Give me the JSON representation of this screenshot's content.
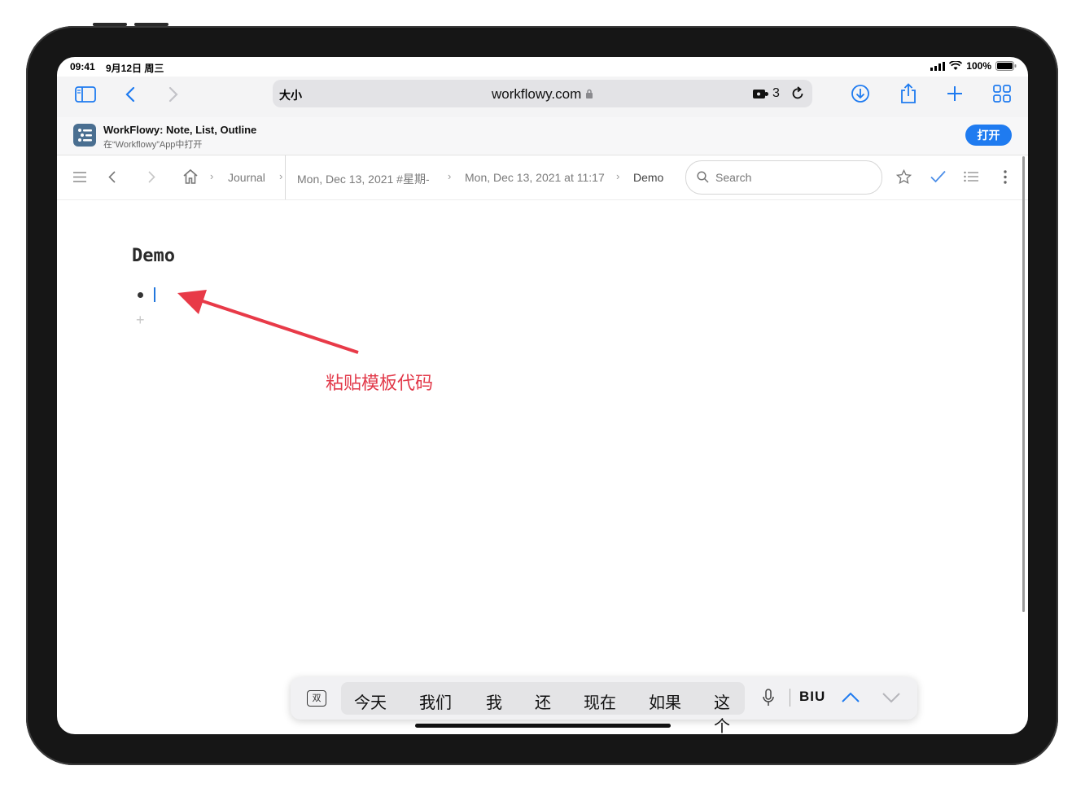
{
  "status_bar": {
    "time": "09:41",
    "date": "9月12日 周三",
    "battery": "100%"
  },
  "safari": {
    "text_size_label": "大小",
    "url": "workflowy.com",
    "extensions_count": "3"
  },
  "app_banner": {
    "title": "WorkFlowy: Note, List, Outline",
    "subtitle": "在“Workflowy”App中打开",
    "open_button": "打开"
  },
  "breadcrumbs": [
    {
      "label": "Journal"
    },
    {
      "label": "Mon, Dec 13, 2021 #星期-"
    },
    {
      "label": "Mon, Dec 13, 2021 at 11:17"
    },
    {
      "label": "Demo"
    }
  ],
  "search": {
    "placeholder": "Search"
  },
  "document": {
    "title": "Demo"
  },
  "annotation": {
    "text": "粘贴模板代码",
    "color": "#e23a4a"
  },
  "keyboard_bar": {
    "candidates": [
      "今天",
      "我们",
      "我",
      "还",
      "现在",
      "如果",
      "这个"
    ],
    "format_label": "BIU",
    "mode_icon": "双"
  },
  "colors": {
    "accent": "#1f7bf0",
    "annotation": "#e23a4a"
  }
}
